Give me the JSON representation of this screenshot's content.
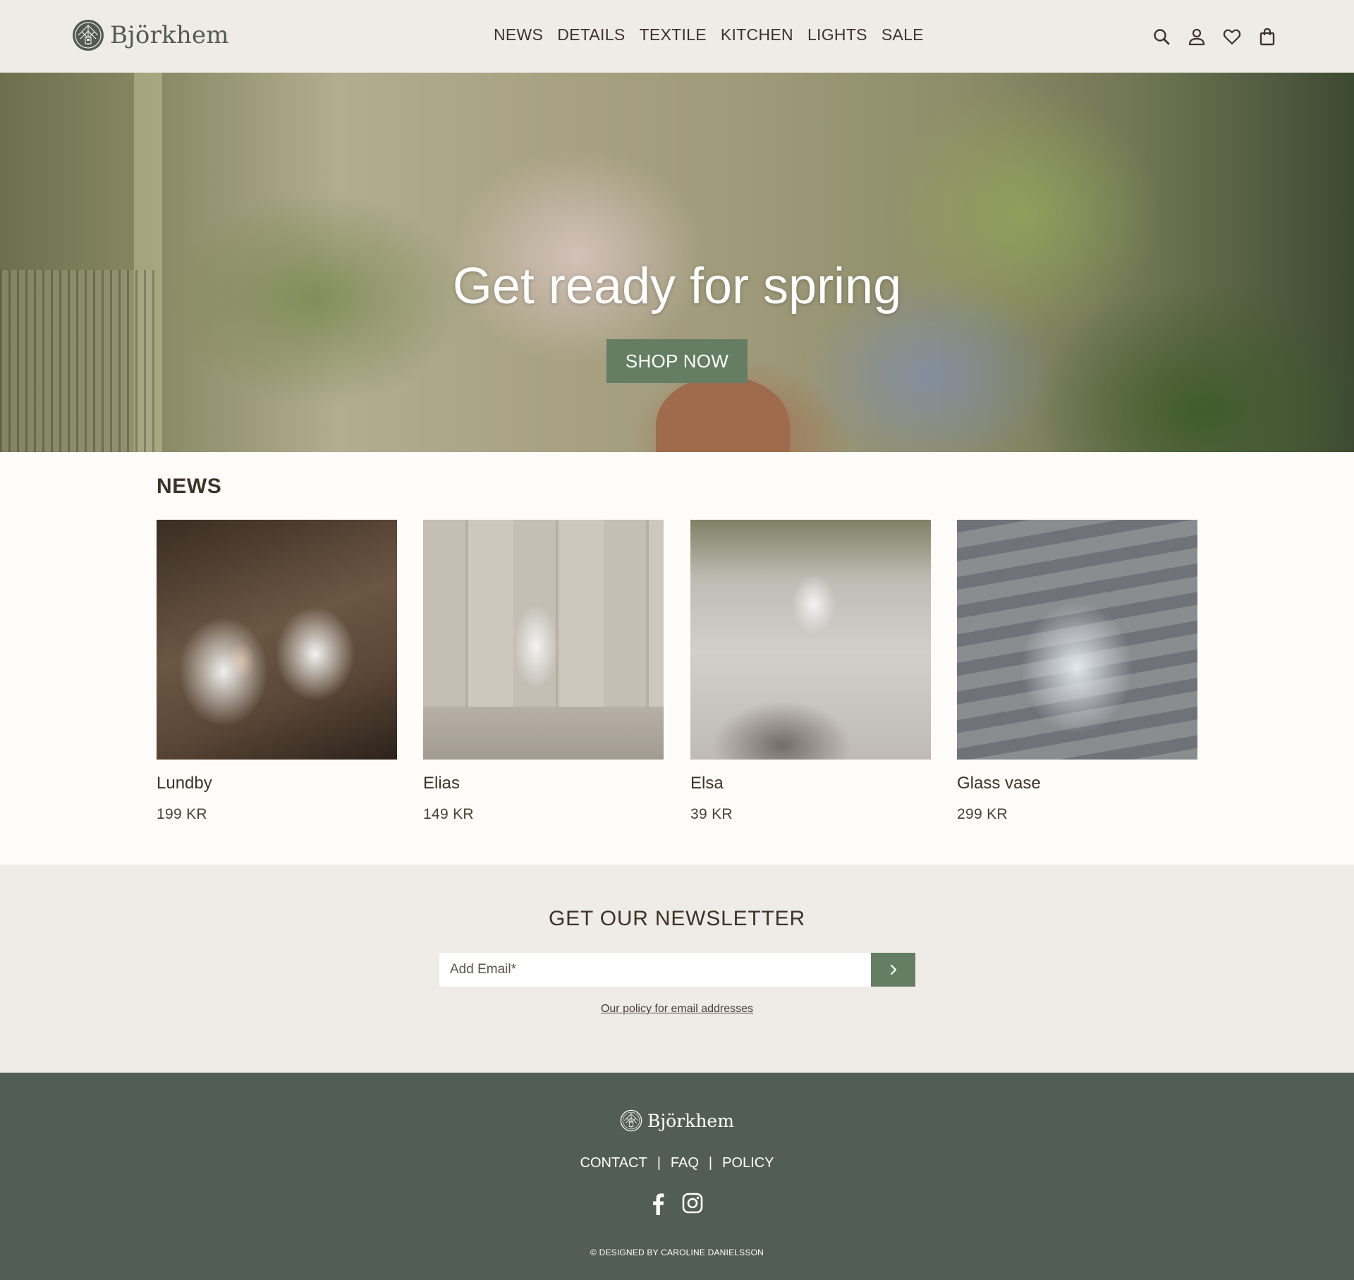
{
  "brand": {
    "name": "Björkhem"
  },
  "nav": {
    "items": [
      {
        "label": "NEWS"
      },
      {
        "label": "DETAILS"
      },
      {
        "label": "TEXTILE"
      },
      {
        "label": "KITCHEN"
      },
      {
        "label": "LIGHTS"
      },
      {
        "label": "SALE"
      }
    ]
  },
  "header_icons": [
    "search-icon",
    "user-icon",
    "heart-icon",
    "shopping-bag-icon"
  ],
  "hero": {
    "title": "Get ready for spring",
    "cta": "SHOP NOW"
  },
  "news": {
    "title": "NEWS",
    "products": [
      {
        "name": "Lundby",
        "price": "199 KR"
      },
      {
        "name": "Elias",
        "price": "149 KR"
      },
      {
        "name": "Elsa",
        "price": "39 KR"
      },
      {
        "name": "Glass vase",
        "price": "299 KR"
      }
    ]
  },
  "newsletter": {
    "title": "GET OUR NEWSLETTER",
    "placeholder": "Add Email*",
    "value": "",
    "policy_link": "Our policy for email addresses"
  },
  "footer": {
    "brand": "Björkhem",
    "links": [
      {
        "label": "CONTACT"
      },
      {
        "label": "FAQ"
      },
      {
        "label": "POLICY"
      }
    ],
    "separator": "|",
    "social_icons": [
      "facebook-icon",
      "instagram-icon"
    ],
    "copyright": "© DESIGNED BY CAROLINE DANIELSSON"
  },
  "colors": {
    "header_bg": "#efebe7",
    "accent_green": "#657d63",
    "footer_bg": "#525d55",
    "text": "#3d3328",
    "page_bg": "#fdfcf8"
  }
}
